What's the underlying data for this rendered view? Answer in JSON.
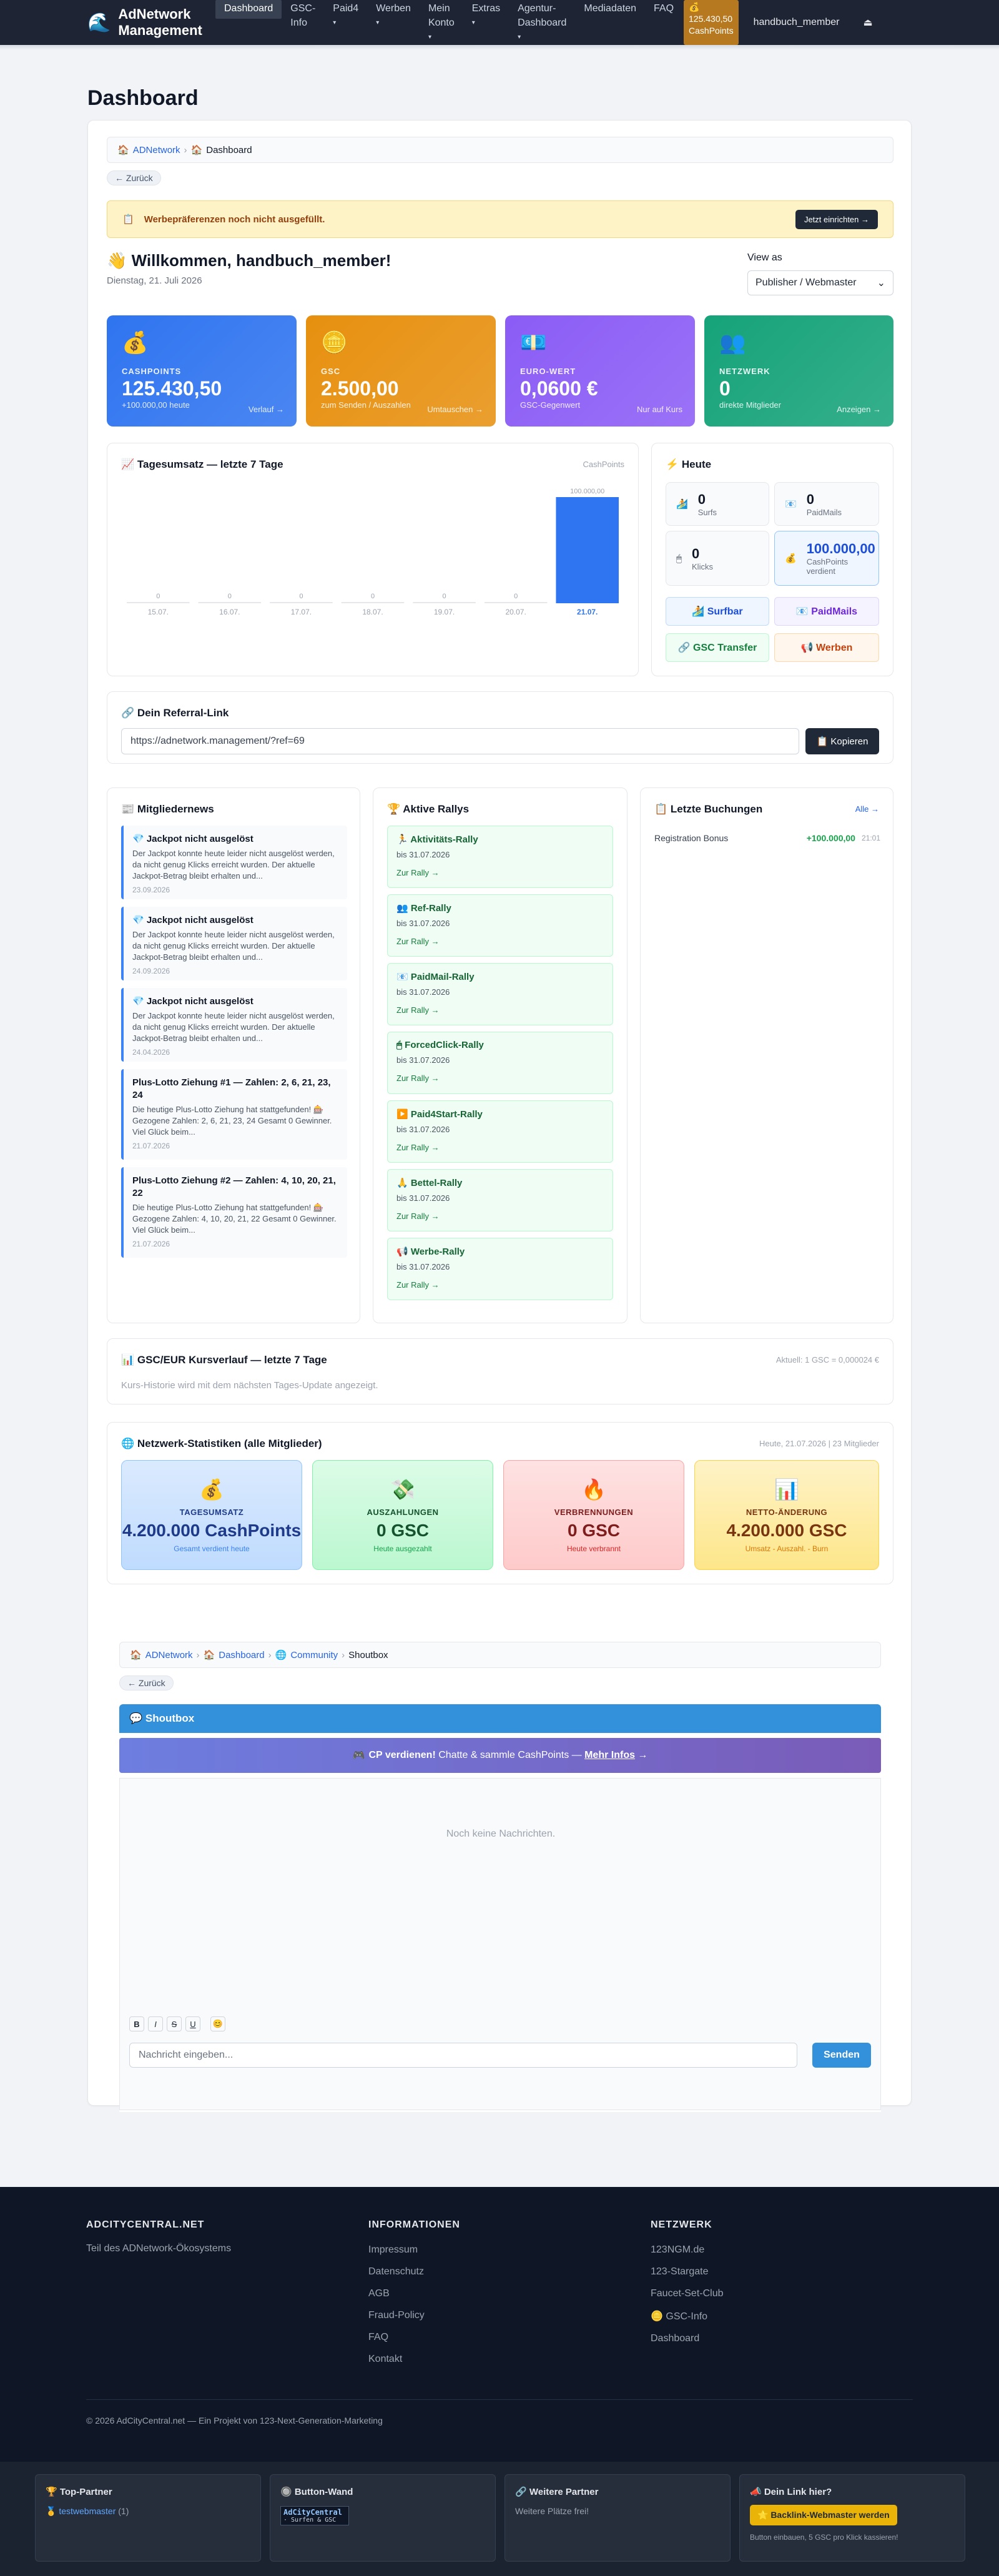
{
  "nav": {
    "brand_line1": "AdNetwork",
    "brand_line2": "Management",
    "items": [
      {
        "label": "Dashboard",
        "caret": ""
      },
      {
        "label": "GSC-",
        "label2": "Info",
        "caret": ""
      },
      {
        "label": "Paid4",
        "caret": "▾"
      },
      {
        "label": "Werben",
        "caret": "▾"
      },
      {
        "label": "Mein",
        "label2": "Konto",
        "caret": "▾"
      },
      {
        "label": "Extras",
        "caret": "▾"
      },
      {
        "label": "Agentur-",
        "label2": "Dashboard",
        "caret": "▾"
      },
      {
        "label": "Mediadaten",
        "caret": ""
      },
      {
        "label": "FAQ",
        "caret": ""
      }
    ],
    "cp_icon": "💰",
    "cp_value": "125.430,50",
    "cp_unit": "CashPoints",
    "user": "handbuch_member",
    "logout_icon": "⏏"
  },
  "page_title": "Dashboard",
  "breadcrumb": {
    "home_icon": "🏠",
    "home": "ADNetwork",
    "current": "Dashboard"
  },
  "back_label": "← Zurück",
  "warning": {
    "icon": "📋",
    "text": "Werbepräferenzen noch nicht ausgefüllt.",
    "button": "Jetzt einrichten →"
  },
  "welcome": {
    "text": "👋 Willkommen, handbuch_member!",
    "date": "Dienstag, 21. Juli 2026",
    "view_as_label": "View as",
    "view_as_value": "Publisher / Webmaster"
  },
  "stats": [
    {
      "icon": "💰",
      "label": "CASHPOINTS",
      "value": "125.430,50",
      "sub": "+100.000,00 heute",
      "link": "Verlauf →",
      "color": "#2f74f0"
    },
    {
      "icon": "🪙",
      "label": "GSC",
      "value": "2.500,00",
      "sub": "zum Senden / Auszahlen",
      "link": "Umtauschen →",
      "color": "#e7900f"
    },
    {
      "icon": "💶",
      "label": "EURO-WERT",
      "value": "0,0600 €",
      "sub": "GSC-Gegenwert",
      "link": "Nur auf Kurs",
      "color": "#8b5cf6"
    },
    {
      "icon": "👥",
      "label": "NETZWERK",
      "value": "0",
      "sub": "direkte Mitglieder",
      "link": "Anzeigen →",
      "color": "#16a37a"
    }
  ],
  "chart_data": {
    "type": "bar",
    "title": "📈 Tagesumsatz — letzte 7 Tage",
    "unit": "CashPoints",
    "categories": [
      "15.07.",
      "16.07.",
      "17.07.",
      "18.07.",
      "19.07.",
      "20.07.",
      "21.07."
    ],
    "values": [
      0,
      0,
      0,
      0,
      0,
      0,
      100000
    ],
    "value_labels": [
      "0",
      "0",
      "0",
      "0",
      "0",
      "0",
      "100.000,00"
    ],
    "ylim": [
      0,
      100000
    ],
    "highlight_color": "#2f74f0",
    "base_color": "#e5e7eb"
  },
  "today": {
    "title": "⚡ Heute",
    "tiles": [
      {
        "icon": "🏄",
        "num": "0",
        "cap": "Surfs"
      },
      {
        "icon": "📧",
        "num": "0",
        "cap": "PaidMails"
      },
      {
        "icon": "🖱",
        "num": "0",
        "cap": "Klicks"
      },
      {
        "icon": "💰",
        "num": "100.000,00",
        "cap": "CashPoints",
        "cap2": "verdient"
      }
    ],
    "buttons": [
      {
        "label": "🏄 Surfbar",
        "bg": "#eff6ff",
        "border": "#bfdbfe",
        "color": "#1d4ed8"
      },
      {
        "label": "📧 PaidMails",
        "bg": "#f5f3ff",
        "border": "#ddd6fe",
        "color": "#6d28d9"
      },
      {
        "label": "🔗 GSC Transfer",
        "bg": "#f0fdf4",
        "border": "#bbf7d0",
        "color": "#15803d"
      },
      {
        "label": "📢 Werben",
        "bg": "#fff7ed",
        "border": "#fed7aa",
        "color": "#c2410c"
      }
    ]
  },
  "referral": {
    "title": "🔗 Dein Referral-Link",
    "url": "https://adnetwork.management/?ref=69",
    "button": "📋 Kopieren"
  },
  "news": {
    "title": "📰 Mitgliedernews",
    "items": [
      {
        "title": "💎 Jackpot nicht ausgelöst",
        "text": "Der Jackpot konnte heute leider nicht ausgelöst werden, da nicht genug Klicks erreicht wurden. Der aktuelle Jackpot-Betrag bleibt erhalten und...",
        "date": "23.09.2026"
      },
      {
        "title": "💎 Jackpot nicht ausgelöst",
        "text": "Der Jackpot konnte heute leider nicht ausgelöst werden, da nicht genug Klicks erreicht wurden. Der aktuelle Jackpot-Betrag bleibt erhalten und...",
        "date": "24.09.2026"
      },
      {
        "title": "💎 Jackpot nicht ausgelöst",
        "text": "Der Jackpot konnte heute leider nicht ausgelöst werden, da nicht genug Klicks erreicht wurden. Der aktuelle Jackpot-Betrag bleibt erhalten und...",
        "date": "24.04.2026"
      },
      {
        "title": "Plus-Lotto Ziehung #1 — Zahlen: 2, 6, 21, 23, 24",
        "text": "Die heutige Plus-Lotto Ziehung hat stattgefunden! 🎰 Gezogene Zahlen: 2, 6, 21, 23, 24 Gesamt 0 Gewinner. Viel Glück beim...",
        "date": "21.07.2026"
      },
      {
        "title": "Plus-Lotto Ziehung #2 — Zahlen: 4, 10, 20, 21, 22",
        "text": "Die heutige Plus-Lotto Ziehung hat stattgefunden! 🎰 Gezogene Zahlen: 4, 10, 20, 21, 22 Gesamt 0 Gewinner. Viel Glück beim...",
        "date": "21.07.2026"
      }
    ]
  },
  "rallies": {
    "title": "🏆 Aktive Rallys",
    "items": [
      {
        "title": "🏃 Aktivitäts-Rally",
        "date": "bis 31.07.2026",
        "link": "Zur Rally →"
      },
      {
        "title": "👥 Ref-Rally",
        "date": "bis 31.07.2026",
        "link": "Zur Rally →"
      },
      {
        "title": "📧 PaidMail-Rally",
        "date": "bis 31.07.2026",
        "link": "Zur Rally →"
      },
      {
        "title": "🖱 ForcedClick-Rally",
        "date": "bis 31.07.2026",
        "link": "Zur Rally →"
      },
      {
        "title": "▶️ Paid4Start-Rally",
        "date": "bis 31.07.2026",
        "link": "Zur Rally →"
      },
      {
        "title": "🙏 Bettel-Rally",
        "date": "bis 31.07.2026",
        "link": "Zur Rally →"
      },
      {
        "title": "📢 Werbe-Rally",
        "date": "bis 31.07.2026",
        "link": "Zur Rally →"
      }
    ]
  },
  "bookings": {
    "title": "📋 Letzte Buchungen",
    "all_link": "Alle →",
    "rows": [
      {
        "label": "Registration Bonus",
        "amount": "+100.000,00",
        "time": "21:01"
      }
    ]
  },
  "gsc": {
    "title": "📊 GSC/EUR Kursverlauf — letzte 7 Tage",
    "current": "Aktuell: 1 GSC = 0,000024 €",
    "note": "Kurs-Historie wird mit dem nächsten Tages-Update angezeigt."
  },
  "network": {
    "title": "🌐 Netzwerk-Statistiken (alle Mitglieder)",
    "meta": "Heute, 21.07.2026 | 23 Mitglieder",
    "cards": [
      {
        "icon": "💰",
        "label": "TAGESUMSATZ",
        "value": "4.200.000 CashPoints",
        "sub": "Gesamt verdient heute",
        "bg": "linear-gradient(180deg,#dbeafe,#bfdbfe)",
        "border": "#93c5fd",
        "color": "#1e3a8a",
        "subcolor": "#3b82f6"
      },
      {
        "icon": "💸",
        "label": "AUSZAHLUNGEN",
        "value": "0 GSC",
        "sub": "Heute ausgezahlt",
        "bg": "linear-gradient(180deg,#dcfce7,#bbf7d0)",
        "border": "#86efac",
        "color": "#14532d",
        "subcolor": "#16a34a"
      },
      {
        "icon": "🔥",
        "label": "VERBRENNUNGEN",
        "value": "0 GSC",
        "sub": "Heute verbrannt",
        "bg": "linear-gradient(180deg,#fee2e2,#fecaca)",
        "border": "#fca5a5",
        "color": "#7f1d1d",
        "subcolor": "#dc2626"
      },
      {
        "icon": "📊",
        "label": "NETTO-ÄNDERUNG",
        "value": "4.200.000 GSC",
        "sub": "Umsatz - Auszahl. - Burn",
        "bg": "linear-gradient(180deg,#fef3c7,#fde68a)",
        "border": "#fcd34d",
        "color": "#78350f",
        "subcolor": "#d97706"
      }
    ]
  },
  "shoutbox": {
    "breadcrumb": {
      "home": "ADNetwork",
      "dash": "Dashboard",
      "community_icon": "🌐",
      "community": "Community",
      "current": "Shoutbox"
    },
    "title": "💬 Shoutbox",
    "banner_icon": "🎮",
    "banner_bold": "CP verdienen!",
    "banner_text": " Chatte & sammle CashPoints — ",
    "banner_link": "Mehr Infos",
    "banner_arrow": " →",
    "empty": "Noch keine Nachrichten.",
    "fmt": [
      "B",
      "I",
      "S",
      "U",
      "😊"
    ],
    "placeholder": "Nachricht eingeben...",
    "send": "Senden"
  },
  "footer": {
    "col1_title": "ADCITYCENTRAL.NET",
    "col1_text": "Teil des ADNetwork-Ökosystems",
    "col2_title": "INFORMATIONEN",
    "col2_links": [
      "Impressum",
      "Datenschutz",
      "AGB",
      "Fraud-Policy",
      "FAQ",
      "Kontakt"
    ],
    "col3_title": "NETZWERK",
    "col3_links": [
      "123NGM.de",
      "123-Stargate",
      "Faucet-Set-Club",
      "🪙 GSC-Info",
      "Dashboard"
    ],
    "copyright": "© 2026 AdCityCentral.net — Ein Projekt von 123-Next-Generation-Marketing"
  },
  "partners": {
    "top_title": "🏆 Top-Partner",
    "top_item": "🥇 testwebmaster",
    "top_count": "(1)",
    "wall_title": "🔘 Button-Wand",
    "wall_line1": "AdCityCentral",
    "wall_line2": "· Surfen & GSC",
    "more_title": "🔗 Weitere Partner",
    "more_text": "Weitere Plätze frei!",
    "link_title": "📣 Dein Link hier?",
    "link_button": "⭐ Backlink-Webmaster werden",
    "link_text": "Button einbauen, 5 GSC pro Klick kassieren!"
  }
}
